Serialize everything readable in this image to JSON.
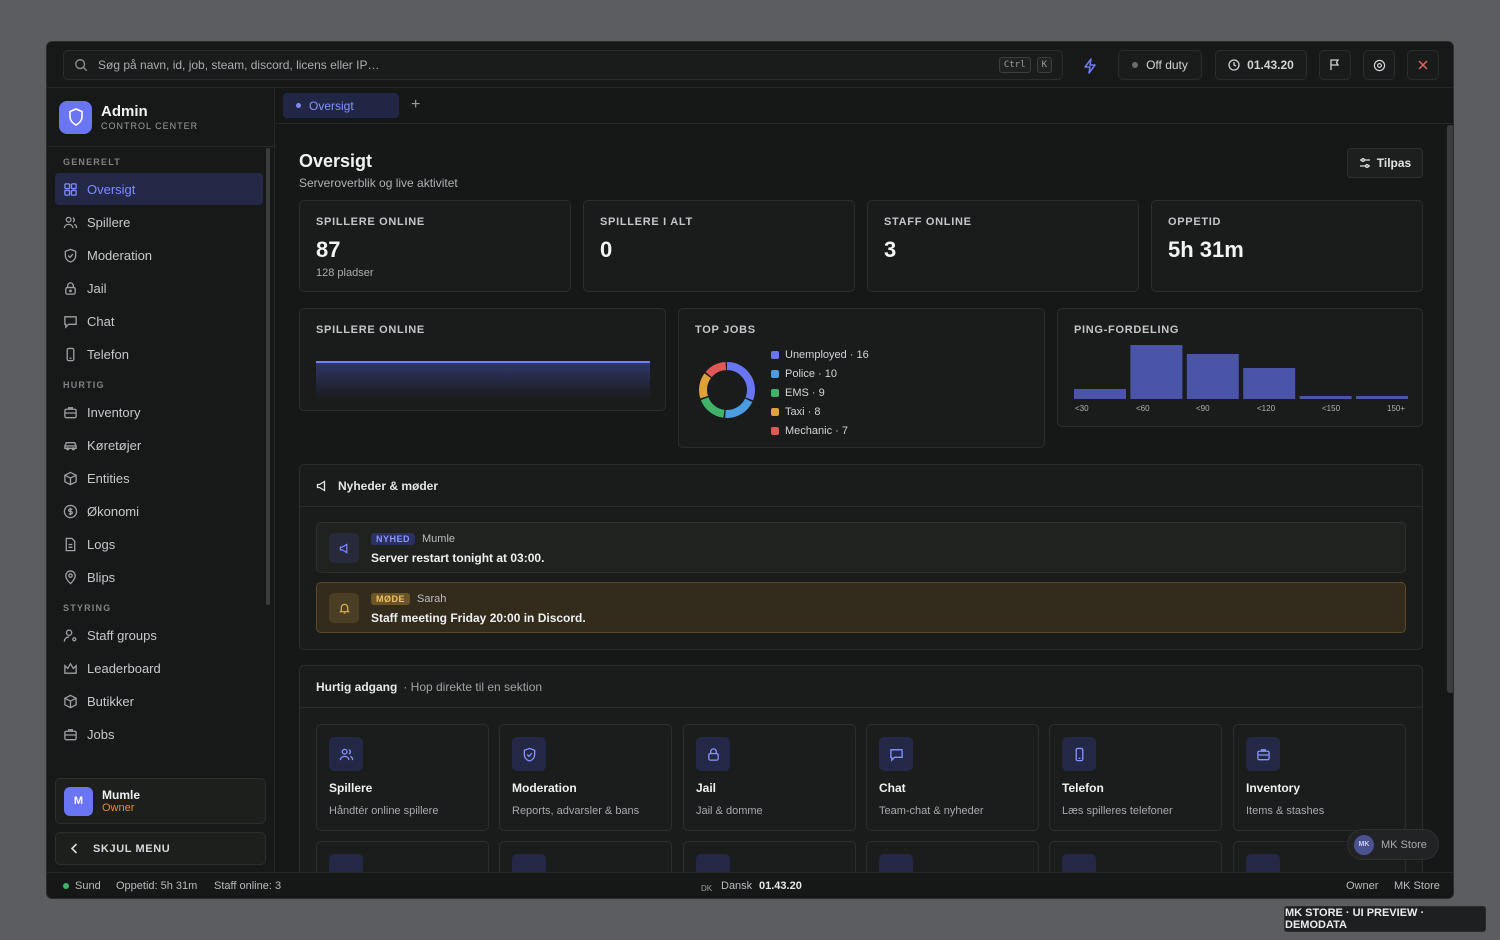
{
  "search": {
    "placeholder": "Søg på navn, id, job, steam, discord, licens eller IP…",
    "kbd1": "Ctrl",
    "kbd2": "K"
  },
  "topbar": {
    "duty": "Off duty",
    "clock": "01.43.20"
  },
  "brand": {
    "title": "Admin",
    "subtitle": "CONTROL CENTER"
  },
  "sidebar": {
    "sections": [
      {
        "label": "GENERELT",
        "items": [
          {
            "label": "Oversigt",
            "icon": "grid-icon",
            "active": true
          },
          {
            "label": "Spillere",
            "icon": "users-icon"
          },
          {
            "label": "Moderation",
            "icon": "shield-icon"
          },
          {
            "label": "Jail",
            "icon": "lock-icon"
          },
          {
            "label": "Chat",
            "icon": "chat-icon"
          },
          {
            "label": "Telefon",
            "icon": "phone-icon"
          }
        ]
      },
      {
        "label": "HURTIG",
        "items": [
          {
            "label": "Inventory",
            "icon": "briefcase-icon"
          },
          {
            "label": "Køretøjer",
            "icon": "car-icon"
          },
          {
            "label": "Entities",
            "icon": "cube-icon"
          },
          {
            "label": "Økonomi",
            "icon": "dollar-icon"
          },
          {
            "label": "Logs",
            "icon": "file-icon"
          },
          {
            "label": "Blips",
            "icon": "pin-icon"
          }
        ]
      },
      {
        "label": "STYRING",
        "items": [
          {
            "label": "Staff groups",
            "icon": "user-cog-icon"
          },
          {
            "label": "Leaderboard",
            "icon": "crown-icon"
          },
          {
            "label": "Butikker",
            "icon": "cube-icon"
          },
          {
            "label": "Jobs",
            "icon": "briefcase-icon"
          }
        ]
      }
    ],
    "user": {
      "initial": "M",
      "name": "Mumle",
      "role": "Owner"
    },
    "hide_label": "SKJUL MENU"
  },
  "tabs": {
    "active": "Oversigt",
    "add": "+"
  },
  "page": {
    "title": "Oversigt",
    "subtitle": "Serveroverblik og live aktivitet",
    "customize": "Tilpas"
  },
  "stats": [
    {
      "label": "SPILLERE ONLINE",
      "value": "87",
      "sub": "128 pladser"
    },
    {
      "label": "SPILLERE I ALT",
      "value": "0",
      "sub": ""
    },
    {
      "label": "STAFF ONLINE",
      "value": "3",
      "sub": ""
    },
    {
      "label": "OPPETID",
      "value": "5h 31m",
      "sub": ""
    }
  ],
  "widgets": {
    "players": "SPILLERE ONLINE",
    "jobs": "TOP JOBS",
    "ping": "PING-FORDELING"
  },
  "top_jobs": [
    {
      "label": "Unemployed · 16",
      "name": "Unemployed",
      "value": 16,
      "color": "#6a75f3"
    },
    {
      "label": "Police · 10",
      "name": "Police",
      "value": 10,
      "color": "#4a9be0"
    },
    {
      "label": "EMS · 9",
      "name": "EMS",
      "value": 9,
      "color": "#3fb36a"
    },
    {
      "label": "Taxi · 8",
      "name": "Taxi",
      "value": 8,
      "color": "#e0a03a"
    },
    {
      "label": "Mechanic · 7",
      "name": "Mechanic",
      "value": 7,
      "color": "#e05858"
    }
  ],
  "ping": {
    "ticks": [
      "<30",
      "<60",
      "<90",
      "<120",
      "<150",
      "150+"
    ],
    "values": [
      10,
      54,
      45,
      31,
      3,
      3
    ]
  },
  "news": {
    "title": "Nyheder & møder",
    "items": [
      {
        "badge": "NYHED",
        "author": "Mumle",
        "text": "Server restart tonight at 03:00.",
        "type": "news"
      },
      {
        "badge": "MØDE",
        "author": "Sarah",
        "text": "Staff meeting Friday 20:00 in Discord.",
        "type": "meeting"
      }
    ]
  },
  "quick": {
    "title": "Hurtig adgang",
    "subtitle": "· Hop direkte til en sektion",
    "cards": [
      {
        "title": "Spillere",
        "sub": "Håndtér online spillere",
        "icon": "users-icon"
      },
      {
        "title": "Moderation",
        "sub": "Reports, advarsler & bans",
        "icon": "shield-icon"
      },
      {
        "title": "Jail",
        "sub": "Jail & domme",
        "icon": "lock-icon"
      },
      {
        "title": "Chat",
        "sub": "Team-chat & nyheder",
        "icon": "chat-icon"
      },
      {
        "title": "Telefon",
        "sub": "Læs spilleres telefoner",
        "icon": "phone-icon"
      },
      {
        "title": "Inventory",
        "sub": "Items & stashes",
        "icon": "briefcase-icon"
      }
    ]
  },
  "mkstore": {
    "badge": "MK",
    "label": "MK Store"
  },
  "status": {
    "health": "Sund",
    "uptime": "Oppetid: 5h 31m",
    "staff": "Staff online: 3",
    "flag": "DK",
    "lang": "Dansk",
    "time": "01.43.20",
    "role": "Owner",
    "brand": "MK Store"
  },
  "watermark": "MK STORE · UI PREVIEW · DEMODATA"
}
